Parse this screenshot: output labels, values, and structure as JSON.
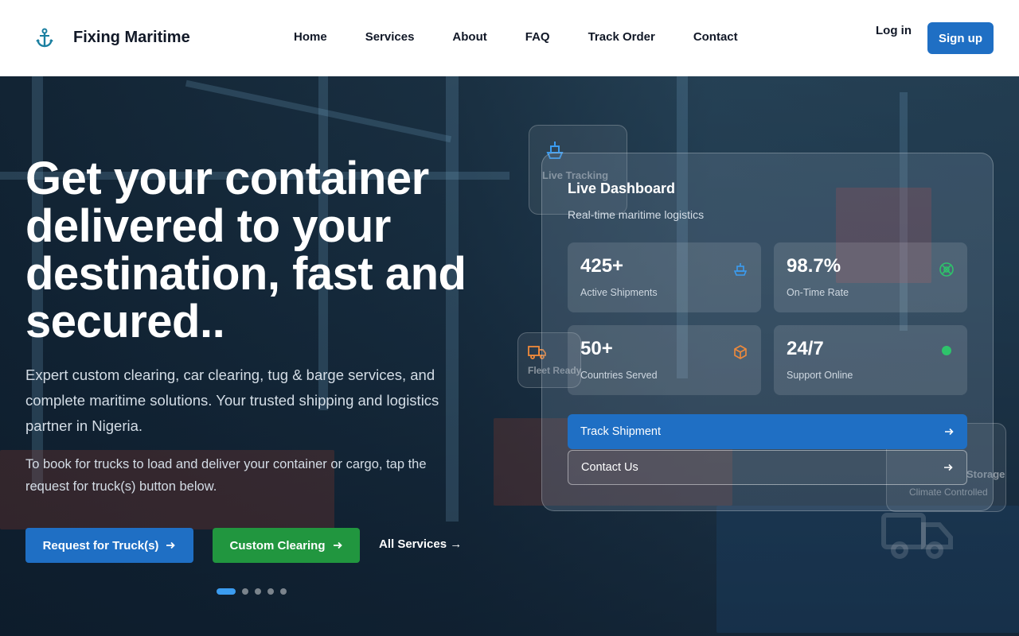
{
  "header": {
    "brand": "Fixing Maritime",
    "nav": [
      "Home",
      "Services",
      "About",
      "FAQ",
      "Track Order",
      "Contact"
    ],
    "login": "Log in",
    "signup": "Sign up"
  },
  "hero": {
    "title": "Get your container delivered to your destination, fast and secured..",
    "subtitle": "Expert custom clearing, car clearing, tug & barge services, and complete maritime solutions. Your trusted shipping and logistics partner in Nigeria.",
    "note": "To book for trucks to load and deliver your container or cargo, tap the request for truck(s) button below.",
    "btn_truck": "Request for Truck(s)",
    "btn_clearing": "Custom Clearing",
    "btn_all": "All Services →",
    "slides_total": 5,
    "slide_active": 1
  },
  "ghost_cards": {
    "card1_title": "Live Tracking",
    "card2_title": "Fleet Ready",
    "card3_title": "Storage",
    "card3_sub": "Climate Controlled"
  },
  "dashboard": {
    "title": "Live Dashboard",
    "subtitle": "Real-time maritime logistics",
    "stats": [
      {
        "value": "425+",
        "label": "Active Shipments",
        "icon": "ship-icon",
        "color": "#3b9cf0"
      },
      {
        "value": "98.7%",
        "label": "On-Time Rate",
        "icon": "target-icon",
        "color": "#2ec36b"
      },
      {
        "value": "50+",
        "label": "Countries Served",
        "icon": "box-icon",
        "color": "#f08a3b"
      },
      {
        "value": "24/7",
        "label": "Support Online",
        "icon": "status-dot-icon",
        "color": "#2ec36b"
      }
    ],
    "btn_track": "Track Shipment",
    "btn_contact": "Contact Us"
  },
  "colors": {
    "primary": "#1f6fc4",
    "success": "#21963f",
    "accent_blue": "#3b9cf0"
  }
}
